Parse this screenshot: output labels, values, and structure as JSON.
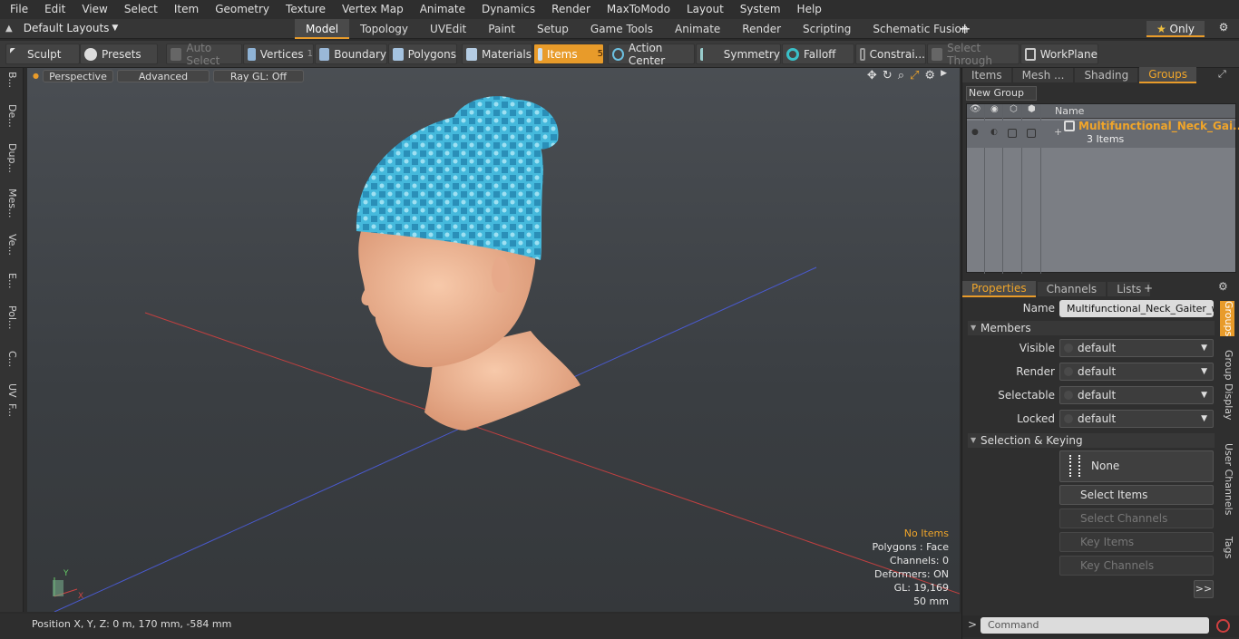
{
  "menu": [
    "File",
    "Edit",
    "View",
    "Select",
    "Item",
    "Geometry",
    "Texture",
    "Vertex Map",
    "Animate",
    "Dynamics",
    "Render",
    "MaxToModo",
    "Layout",
    "System",
    "Help"
  ],
  "layouts": {
    "label": "Default Layouts"
  },
  "mode_tabs": [
    "Model",
    "Topology",
    "UVEdit",
    "Paint",
    "Setup",
    "Game Tools",
    "Animate",
    "Render",
    "Scripting",
    "Schematic Fusion"
  ],
  "active_mode": "Model",
  "plus_label": "+",
  "only_label": "Only",
  "toolbar": {
    "sculpt": "Sculpt",
    "presets": "Presets",
    "auto_select": "Auto Select",
    "vertices": "Vertices",
    "vertices_count": "1",
    "boundary": "Boundary",
    "polygons": "Polygons",
    "materials": "Materials",
    "items": "Items",
    "items_count": "5",
    "action_center": "Action Center",
    "symmetry": "Symmetry",
    "falloff": "Falloff",
    "constraints": "Constrai...",
    "select_through": "Select Through",
    "workplane": "WorkPlane"
  },
  "left_tabs": [
    "B...",
    "De...",
    "Dup...",
    "Mes...",
    "Ve...",
    "E...",
    "Pol...",
    "C...",
    "UV",
    "F..."
  ],
  "viewport": {
    "perspective": "Perspective",
    "advanced": "Advanced",
    "raygl": "Ray GL: Off"
  },
  "stats": {
    "items": "No Items",
    "polygons": "Polygons : Face",
    "channels": "Channels: 0",
    "deformers": "Deformers: ON",
    "gl": "GL: 19,169",
    "units": "50 mm"
  },
  "axis_labels": {
    "x": "X",
    "y": "Y"
  },
  "status": "Position X, Y, Z:   0 m, 170 mm, -584 mm",
  "top_tabs": [
    "Items",
    "Mesh ...",
    "Shading",
    "Groups"
  ],
  "active_top_tab": "Groups",
  "new_group": "New Group",
  "list_header": "Name",
  "group": {
    "name": "Multifunctional_Neck_Gai...",
    "count": "3 Items"
  },
  "prop_tabs": [
    "Properties",
    "Channels",
    "Lists"
  ],
  "props": {
    "name_label": "Name",
    "name_value": "Multifunctional_Neck_Gaiter_wea",
    "members": "Members",
    "visible_label": "Visible",
    "render_label": "Render",
    "selectable_label": "Selectable",
    "locked_label": "Locked",
    "default": "default",
    "sel_key": "Selection & Keying",
    "none": "None",
    "select_items": "Select Items",
    "select_channels": "Select Channels",
    "key_items": "Key Items",
    "key_channels": "Key Channels",
    "more": ">>"
  },
  "side_tabs": [
    "Groups",
    "Group Display",
    "User Channels",
    "Tags"
  ],
  "command_placeholder": "Command",
  "colors": {
    "accent": "#e89b2a",
    "hat": "#3fb7d8",
    "skin": "#f2b696"
  }
}
